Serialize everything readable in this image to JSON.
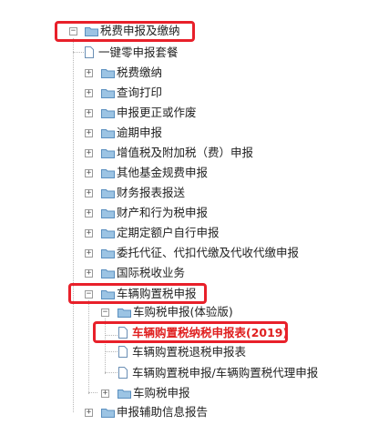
{
  "tree": {
    "root": {
      "label": "税费申报及缴纳",
      "toggle": "−"
    },
    "items": [
      {
        "label": "一键零申报套餐"
      },
      {
        "label": "税费缴纳",
        "toggle": "+"
      },
      {
        "label": "查询打印",
        "toggle": "+"
      },
      {
        "label": "申报更正或作废",
        "toggle": "+"
      },
      {
        "label": "逾期申报",
        "toggle": "+"
      },
      {
        "label": "增值税及附加税（费）申报",
        "toggle": "+"
      },
      {
        "label": "其他基金规费申报",
        "toggle": "+"
      },
      {
        "label": "财务报表报送",
        "toggle": "+"
      },
      {
        "label": "财产和行为税申报",
        "toggle": "+"
      },
      {
        "label": "定期定额户自行申报",
        "toggle": "+"
      },
      {
        "label": "委托代征、代扣代缴及代收代缴申报",
        "toggle": "+"
      },
      {
        "label": "国际税收业务",
        "toggle": "+"
      },
      {
        "label": "车辆购置税申报",
        "toggle": "−"
      },
      {
        "label": "申报辅助信息报告",
        "toggle": "+"
      }
    ],
    "vehicle": {
      "trial": {
        "label": "车购税申报(体验版)",
        "toggle": "−"
      },
      "trial_items": [
        {
          "label": "车辆购置税纳税申报表(2019)"
        },
        {
          "label": "车辆购置税退税申报表"
        },
        {
          "label": "车辆购置税申报/车辆购置税代理申报"
        }
      ],
      "regular": {
        "label": "车购税申报",
        "toggle": "+"
      }
    }
  },
  "colors": {
    "highlight": "#e8202a",
    "selected_text": "#e02020",
    "folder": "#7fb0d8"
  }
}
